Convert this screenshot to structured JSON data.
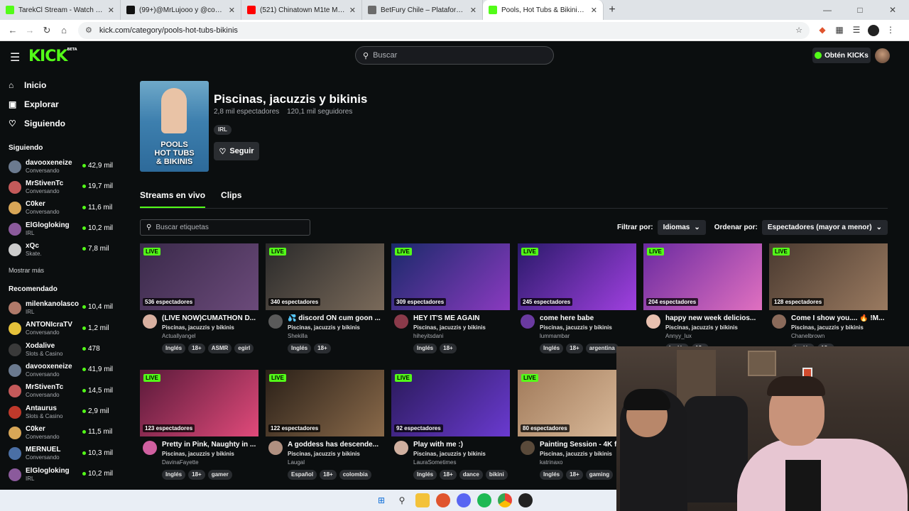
{
  "browser": {
    "tabs": [
      {
        "title": "TarekCl Stream - Watch Live on",
        "color": "#53fc18",
        "active": false
      },
      {
        "title": "(99+)@MrLujooo y @cocolisoo",
        "color": "#111111",
        "active": false
      },
      {
        "title": "(521) Chinatown M1te Mitessj",
        "color": "#ff0000",
        "active": false
      },
      {
        "title": "BetFury Chile – Plataforma de C",
        "color": "#6b6b6b",
        "active": false
      },
      {
        "title": "Pools, Hot Tubs & Bikinis Stream",
        "color": "#53fc18",
        "active": true
      }
    ],
    "url": "kick.com/category/pools-hot-tubs-bikinis"
  },
  "header": {
    "logo": "KICK",
    "logo_badge": "BETA",
    "search_placeholder": "Buscar",
    "kicks_button": "Obtén KICKs"
  },
  "sidebar": {
    "nav": [
      {
        "label": "Inicio",
        "icon": "home-icon"
      },
      {
        "label": "Explorar",
        "icon": "compass-icon"
      },
      {
        "label": "Siguiendo",
        "icon": "heart-icon"
      }
    ],
    "following_heading": "Siguiendo",
    "following": [
      {
        "name": "davooxeneize",
        "category": "Conversando",
        "viewers": "42,9 mil",
        "color": "#6b7a8f"
      },
      {
        "name": "MrStivenTc",
        "category": "Conversando",
        "viewers": "19,7 mil",
        "color": "#c45a5a"
      },
      {
        "name": "C0ker",
        "category": "Conversando",
        "viewers": "11,6 mil",
        "color": "#d8a657"
      },
      {
        "name": "ElGlogloking",
        "category": "IRL",
        "viewers": "10,2 mil",
        "color": "#8b5a9c"
      },
      {
        "name": "xQc",
        "category": "Skate.",
        "viewers": "7,8 mil",
        "color": "#cccccc"
      }
    ],
    "show_more": "Mostrar más",
    "recommended_heading": "Recomendado",
    "recommended": [
      {
        "name": "milenkanolasco",
        "category": "IRL",
        "viewers": "10,4 mil",
        "color": "#b07a6a"
      },
      {
        "name": "ANTONIcraTV",
        "category": "Conversando",
        "viewers": "1,2 mil",
        "color": "#e6c23a"
      },
      {
        "name": "Xodalive",
        "category": "Slots & Casino",
        "viewers": "478",
        "color": "#3a3a3a"
      },
      {
        "name": "davooxeneize",
        "category": "Conversando",
        "viewers": "41,9 mil",
        "color": "#6b7a8f"
      },
      {
        "name": "MrStivenTc",
        "category": "Conversando",
        "viewers": "14,5 mil",
        "color": "#c45a5a"
      },
      {
        "name": "Antaurus",
        "category": "Slots & Casino",
        "viewers": "2,9 mil",
        "color": "#c0392b"
      },
      {
        "name": "C0ker",
        "category": "Conversando",
        "viewers": "11,5 mil",
        "color": "#d8a657"
      },
      {
        "name": "MERNUEL",
        "category": "Conversando",
        "viewers": "10,3 mil",
        "color": "#4a6fa5"
      },
      {
        "name": "ElGlogloking",
        "category": "IRL",
        "viewers": "10,2 mil",
        "color": "#8b5a9c"
      }
    ]
  },
  "category": {
    "title": "Piscinas, jacuzzis y bikinis",
    "viewers": "2,8 mil espectadores",
    "followers": "120,1 mil seguidores",
    "tag": "IRL",
    "follow_label": "Seguir",
    "cover_text": "POOLS\nHOT TUBS\n& BIKINIS"
  },
  "tabs": [
    "Streams en vivo",
    "Clips"
  ],
  "filters": {
    "tag_search_placeholder": "Buscar etiquetas",
    "filter_label": "Filtrar por:",
    "filter_value": "Idiomas",
    "sort_label": "Ordenar por:",
    "sort_value": "Espectadores (mayor a menor)"
  },
  "live_badge": "LIVE",
  "streams": [
    {
      "title": "(LIVE NOW)CUMATHON D...",
      "category": "Piscinas, jacuzzis y bikinis",
      "user": "Actuallyangel",
      "viewers": "536 espectadores",
      "tags": [
        "Inglés",
        "18+",
        "ASMR",
        "egirl"
      ],
      "c1": "#3a2a4a",
      "c2": "#6b4a7a",
      "av": "#d8b0a0"
    },
    {
      "title": "💦 discord ON cum goon ...",
      "category": "Piscinas, jacuzzis y bikinis",
      "user": "Shekilla",
      "viewers": "340 espectadores",
      "tags": [
        "Inglés",
        "18+"
      ],
      "c1": "#2a2a2a",
      "c2": "#7a6a5a",
      "av": "#5a5a5a"
    },
    {
      "title": "HEY IT'S ME AGAIN",
      "category": "Piscinas, jacuzzis y bikinis",
      "user": "hiheyitsdani",
      "viewers": "309 espectadores",
      "tags": [
        "Inglés",
        "18+"
      ],
      "c1": "#1a2a6a",
      "c2": "#8a3ac0",
      "av": "#8a3a4a"
    },
    {
      "title": "come here babe",
      "category": "Piscinas, jacuzzis y bikinis",
      "user": "lummambar",
      "viewers": "245 espectadores",
      "tags": [
        "Inglés",
        "18+",
        "argentina"
      ],
      "c1": "#2a1a6a",
      "c2": "#a040e0",
      "av": "#6a3aa0"
    },
    {
      "title": "happy new week delicios...",
      "category": "Piscinas, jacuzzis y bikinis",
      "user": "Annyy_lux",
      "viewers": "204 espectadores",
      "tags": [
        "Inglés",
        "18+"
      ],
      "c1": "#6a2aa0",
      "c2": "#e070c0",
      "av": "#e8c0b0"
    },
    {
      "title": "Come I show you.... 🔥 !M...",
      "category": "Piscinas, jacuzzis y bikinis",
      "user": "Chanelbrown",
      "viewers": "128 espectadores",
      "tags": [
        "Inglés",
        "18+"
      ],
      "c1": "#4a3a30",
      "c2": "#9a7a60",
      "av": "#8a6a5a"
    },
    {
      "title": "Pretty in Pink, Naughty in ...",
      "category": "Piscinas, jacuzzis y bikinis",
      "user": "DavinaFayette",
      "viewers": "123 espectadores",
      "tags": [
        "Inglés",
        "18+",
        "gamer"
      ],
      "c1": "#5a1a3a",
      "c2": "#e04a7a",
      "av": "#d060a0"
    },
    {
      "title": "A goddess has descende...",
      "category": "Piscinas, jacuzzis y bikinis",
      "user": "Laugal",
      "viewers": "122 espectadores",
      "tags": [
        "Español",
        "18+",
        "colombia"
      ],
      "c1": "#2a2018",
      "c2": "#8a6a4a",
      "av": "#b09080"
    },
    {
      "title": "Play with me :)",
      "category": "Piscinas, jacuzzis y bikinis",
      "user": "LauraSometimes",
      "viewers": "92 espectadores",
      "tags": [
        "Inglés",
        "18+",
        "dance",
        "bikini"
      ],
      "c1": "#2a1a5a",
      "c2": "#6a3ad0",
      "av": "#d0b0a0"
    },
    {
      "title": "Painting Session - 4K fo",
      "category": "Piscinas, jacuzzis y bikinis",
      "user": "katrinaxo",
      "viewers": "80 espectadores",
      "tags": [
        "Inglés",
        "18+",
        "gaming"
      ],
      "c1": "#a07a5a",
      "c2": "#e0c0a0",
      "av": "#5a4a3a"
    }
  ],
  "webcam_overlay": true
}
